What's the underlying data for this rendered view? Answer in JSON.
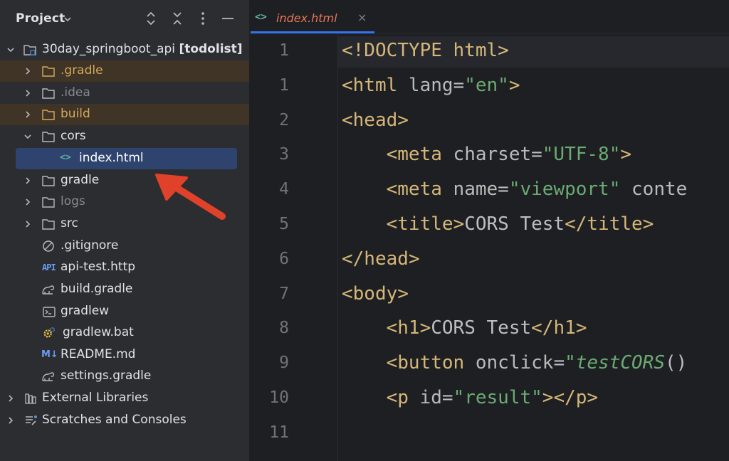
{
  "panel": {
    "title": "Project",
    "header_icons": [
      "expand-collapse-icon",
      "collapse-all-icon",
      "options-icon",
      "hide-icon"
    ]
  },
  "tree": {
    "root": {
      "name": "30day_springboot_api",
      "module": "[todolist]"
    },
    "items": [
      {
        "label": ".gradle"
      },
      {
        "label": ".idea"
      },
      {
        "label": "build"
      },
      {
        "label": "cors"
      },
      {
        "label": "index.html"
      },
      {
        "label": "gradle"
      },
      {
        "label": "logs"
      },
      {
        "label": "src"
      },
      {
        "label": ".gitignore"
      },
      {
        "label": "api-test.http"
      },
      {
        "label": "build.gradle"
      },
      {
        "label": "gradlew"
      },
      {
        "label": "gradlew.bat"
      },
      {
        "label": "README.md"
      },
      {
        "label": "settings.gradle"
      },
      {
        "label": "External Libraries"
      },
      {
        "label": "Scratches and Consoles"
      }
    ],
    "selected": "index.html"
  },
  "editor": {
    "tab": {
      "icon": "<>",
      "label": "index.html",
      "close": "×"
    },
    "line_numbers": [
      "1",
      "1",
      "2",
      "3",
      "4",
      "5",
      "6",
      "7",
      "8",
      "9",
      "10",
      "11"
    ],
    "lines": [
      [
        [
          "t-br",
          "<!DOCTYPE html>"
        ]
      ],
      [
        [
          "t-br",
          "<html "
        ],
        [
          "t-attr",
          "lang"
        ],
        [
          "t-eq",
          "="
        ],
        [
          "t-str",
          "\"en\""
        ],
        [
          "t-br",
          ">"
        ]
      ],
      [
        [
          "t-br",
          "<head>"
        ]
      ],
      [
        [
          "t-txt",
          "    "
        ],
        [
          "t-br",
          "<meta "
        ],
        [
          "t-attr",
          "charset"
        ],
        [
          "t-eq",
          "="
        ],
        [
          "t-str",
          "\"UTF-8\""
        ],
        [
          "t-br",
          ">"
        ]
      ],
      [
        [
          "t-txt",
          "    "
        ],
        [
          "t-br",
          "<meta "
        ],
        [
          "t-attr",
          "name"
        ],
        [
          "t-eq",
          "="
        ],
        [
          "t-str",
          "\"viewport\""
        ],
        [
          "t-attr",
          " conte"
        ]
      ],
      [
        [
          "t-txt",
          "    "
        ],
        [
          "t-br",
          "<title>"
        ],
        [
          "t-txt",
          "CORS Test"
        ],
        [
          "t-br",
          "</title>"
        ]
      ],
      [
        [
          "t-br",
          "</head>"
        ]
      ],
      [
        [
          "t-br",
          "<body>"
        ]
      ],
      [
        [
          "t-txt",
          "    "
        ],
        [
          "t-br",
          "<h1>"
        ],
        [
          "t-txt",
          "CORS Test"
        ],
        [
          "t-br",
          "</h1>"
        ]
      ],
      [
        [
          "t-txt",
          "    "
        ],
        [
          "t-br",
          "<button "
        ],
        [
          "t-attr",
          "onclick"
        ],
        [
          "t-eq",
          "="
        ],
        [
          "t-str",
          "\""
        ],
        [
          "t-js",
          "testCORS"
        ],
        [
          "t-txt",
          "()"
        ]
      ],
      [
        [
          "t-txt",
          "    "
        ],
        [
          "t-br",
          "<p "
        ],
        [
          "t-attr",
          "id"
        ],
        [
          "t-eq",
          "="
        ],
        [
          "t-str",
          "\"result\""
        ],
        [
          "t-br",
          "></p>"
        ]
      ],
      [
        [
          "t-txt",
          ""
        ]
      ]
    ]
  },
  "annotation": {
    "arrow_color": "#e0412a"
  },
  "colors": {
    "panel_bg": "#2b2d30",
    "editor_bg": "#1e1f22",
    "selection": "#2e436e",
    "excluded_highlight": "#3f3425",
    "accent": "#3574f0"
  }
}
